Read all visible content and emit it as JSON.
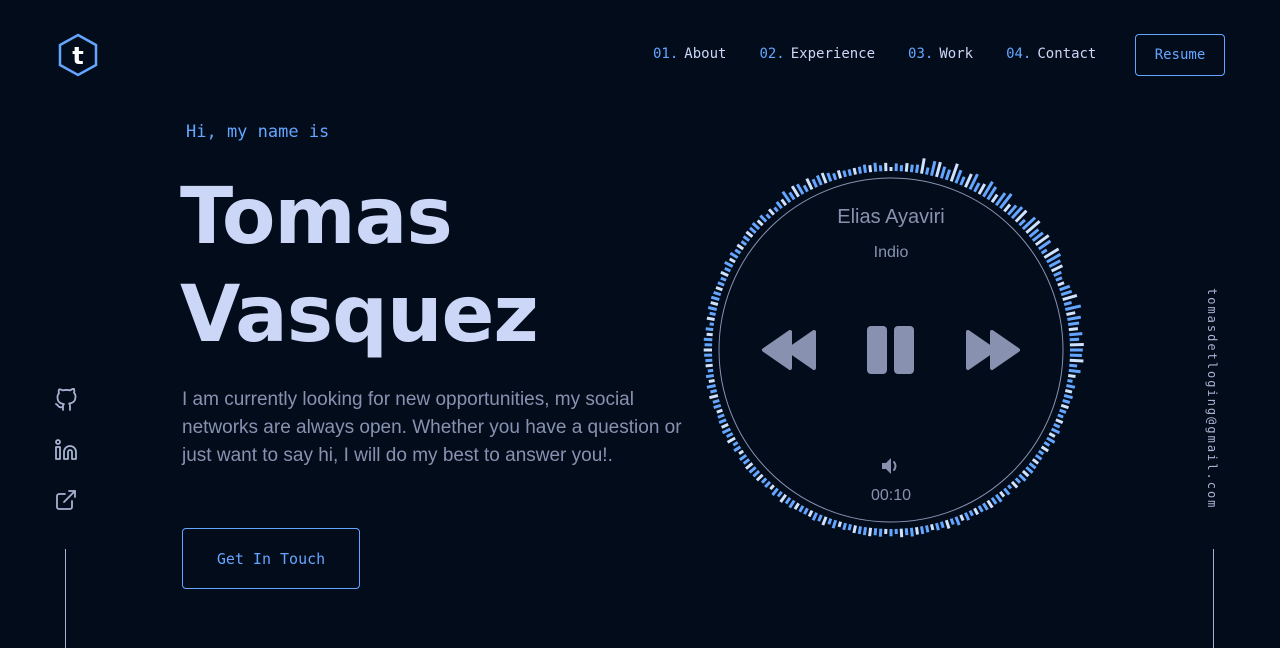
{
  "colors": {
    "background": "#020c1b",
    "accent": "#64a6ff",
    "heading": "#ccd6f6",
    "body": "#8892b0"
  },
  "logo": {
    "letter": "t",
    "icon": "hexagon-logo-icon"
  },
  "nav": {
    "items": [
      {
        "num": "01.",
        "label": "About"
      },
      {
        "num": "02.",
        "label": "Experience"
      },
      {
        "num": "03.",
        "label": "Work"
      },
      {
        "num": "04.",
        "label": "Contact"
      }
    ],
    "resume_label": "Resume"
  },
  "hero": {
    "greeting": "Hi, my name is",
    "first_name": "Tomas",
    "last_name": "Vasquez",
    "bio": "I am currently looking for new opportunities, my social networks are always open. Whether you have a question or just want to say hi, I will do my best to answer you!.",
    "cta_label": "Get In Touch"
  },
  "social": {
    "icons": [
      "github-icon",
      "linkedin-icon",
      "external-link-icon"
    ]
  },
  "email": "tomasdetloging@gmail.com",
  "player": {
    "artist": "Elias Ayaviri",
    "track": "Indio",
    "time": "00:10",
    "icons": [
      "rewind-icon",
      "pause-icon",
      "fast-forward-icon",
      "volume-icon"
    ]
  }
}
